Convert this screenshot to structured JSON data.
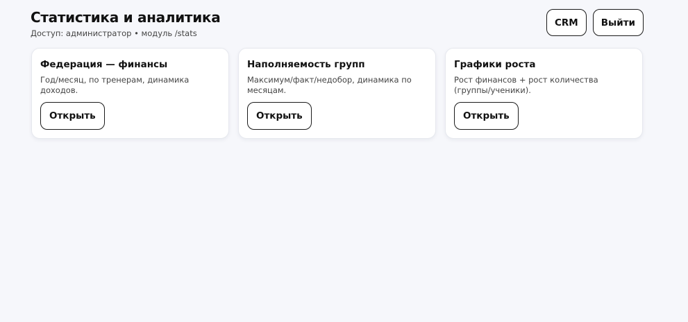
{
  "header": {
    "title": "Статистика и аналитика",
    "subtitle": "Доступ: администратор • модуль /stats"
  },
  "actions": {
    "crm_label": "CRM",
    "logout_label": "Выйти"
  },
  "cards": [
    {
      "title": "Федерация — финансы",
      "description": "Год/месяц, по тренерам, динамика доходов.",
      "button_label": "Открыть"
    },
    {
      "title": "Наполняемость групп",
      "description": "Максимум/факт/недобор, динамика по месяцам.",
      "button_label": "Открыть"
    },
    {
      "title": "Графики роста",
      "description": "Рост финансов + рост количества (группы/ученики).",
      "button_label": "Открыть"
    }
  ]
}
